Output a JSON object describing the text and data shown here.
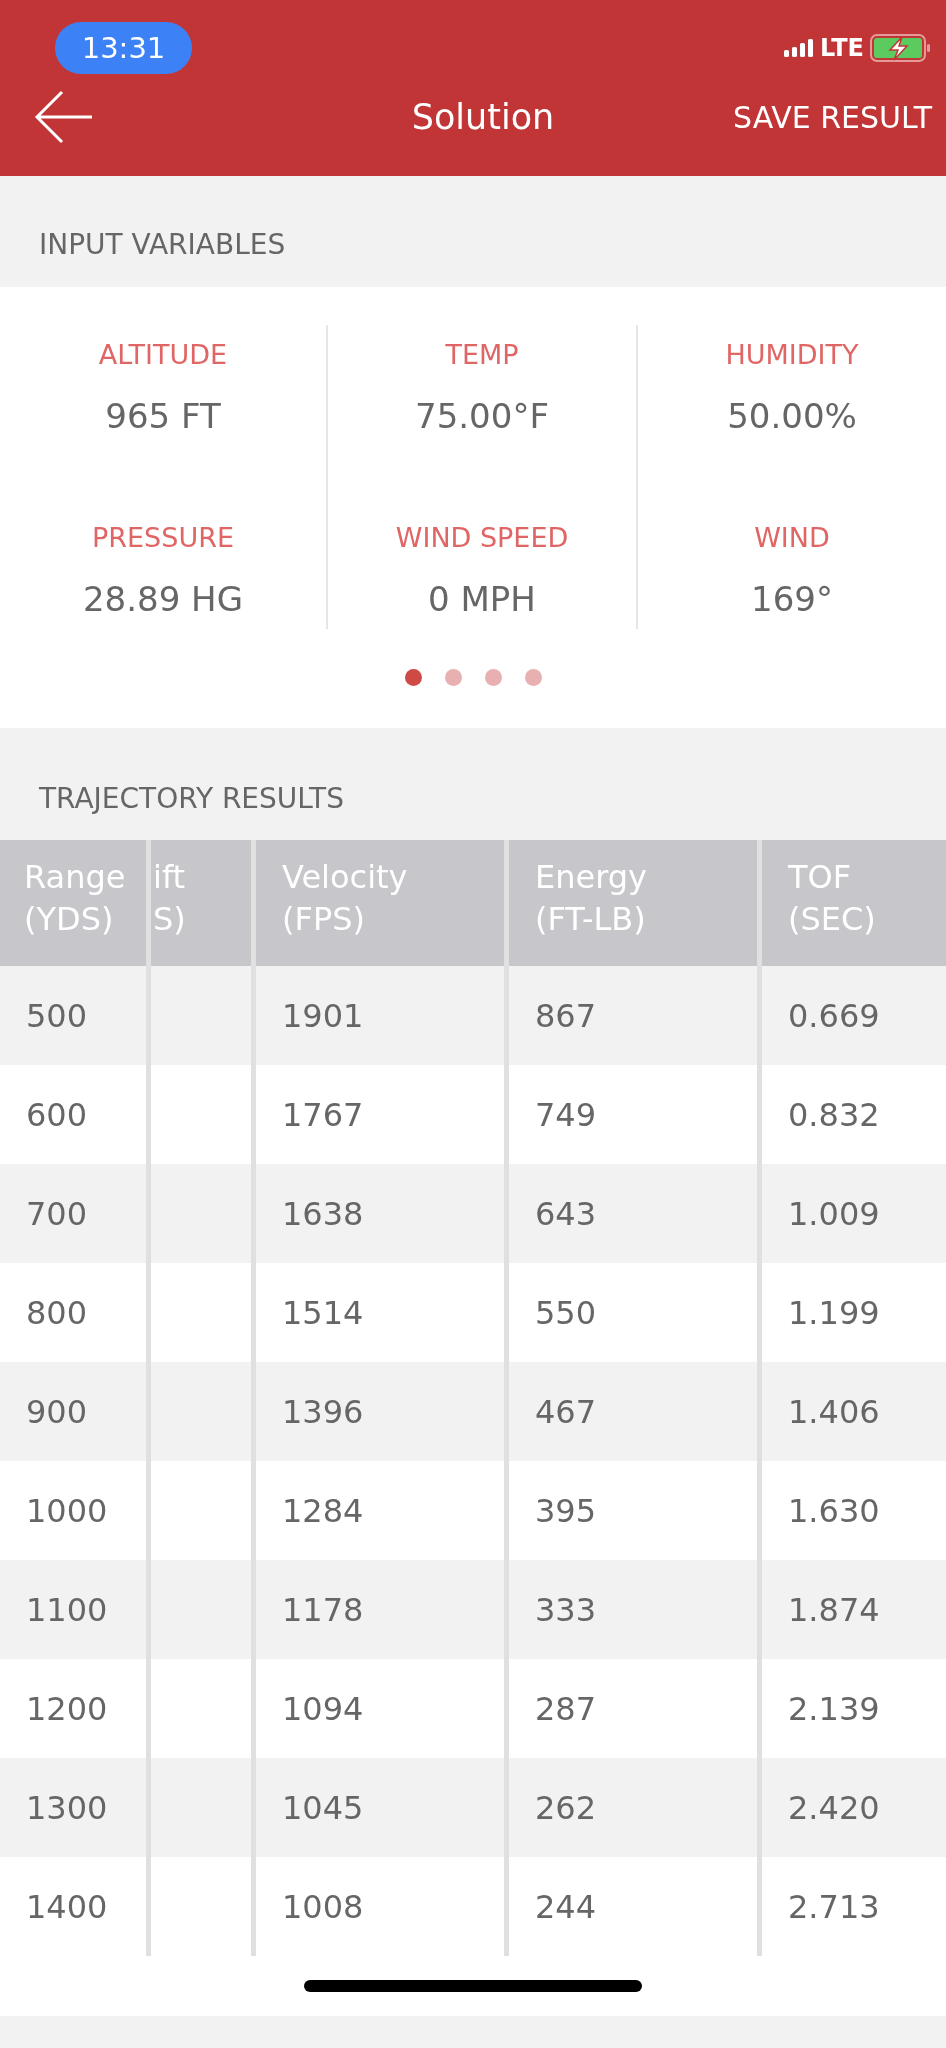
{
  "status_bar": {
    "time": "13:31",
    "network": "LTE"
  },
  "nav_bar": {
    "title": "Solution",
    "action": "SAVE RESULT"
  },
  "input_variables": {
    "title": "INPUT VARIABLES",
    "items": [
      {
        "label": "ALTITUDE",
        "value": "965 FT"
      },
      {
        "label": "TEMP",
        "value": "75.00°F"
      },
      {
        "label": "HUMIDITY",
        "value": "50.00%"
      },
      {
        "label": "PRESSURE",
        "value": "28.89 HG"
      },
      {
        "label": "WIND SPEED",
        "value": "0 MPH"
      },
      {
        "label": "WIND",
        "value": "169°"
      }
    ],
    "pages": [
      {
        "selected": true
      },
      {
        "selected": false
      },
      {
        "selected": false
      },
      {
        "selected": false
      }
    ]
  },
  "trajectory_results": {
    "title": "TRAJECTORY RESULTS",
    "columns": [
      {
        "name": "Range",
        "unit": "(YDS)"
      },
      {
        "name": "ift",
        "unit": "S)"
      },
      {
        "name": "Velocity",
        "unit": "(FPS)"
      },
      {
        "name": "Energy",
        "unit": "(FT-LB)"
      },
      {
        "name": "TOF",
        "unit": "(SEC)"
      }
    ],
    "rows": [
      {
        "range": "500",
        "velocity": "1901",
        "energy": "867",
        "tof": "0.669"
      },
      {
        "range": "600",
        "velocity": "1767",
        "energy": "749",
        "tof": "0.832"
      },
      {
        "range": "700",
        "velocity": "1638",
        "energy": "643",
        "tof": "1.009"
      },
      {
        "range": "800",
        "velocity": "1514",
        "energy": "550",
        "tof": "1.199"
      },
      {
        "range": "900",
        "velocity": "1396",
        "energy": "467",
        "tof": "1.406"
      },
      {
        "range": "1000",
        "velocity": "1284",
        "energy": "395",
        "tof": "1.630"
      },
      {
        "range": "1100",
        "velocity": "1178",
        "energy": "333",
        "tof": "1.874"
      },
      {
        "range": "1200",
        "velocity": "1094",
        "energy": "287",
        "tof": "2.139"
      },
      {
        "range": "1300",
        "velocity": "1045",
        "energy": "262",
        "tof": "2.420"
      },
      {
        "range": "1400",
        "velocity": "1008",
        "energy": "244",
        "tof": "2.713"
      }
    ]
  }
}
